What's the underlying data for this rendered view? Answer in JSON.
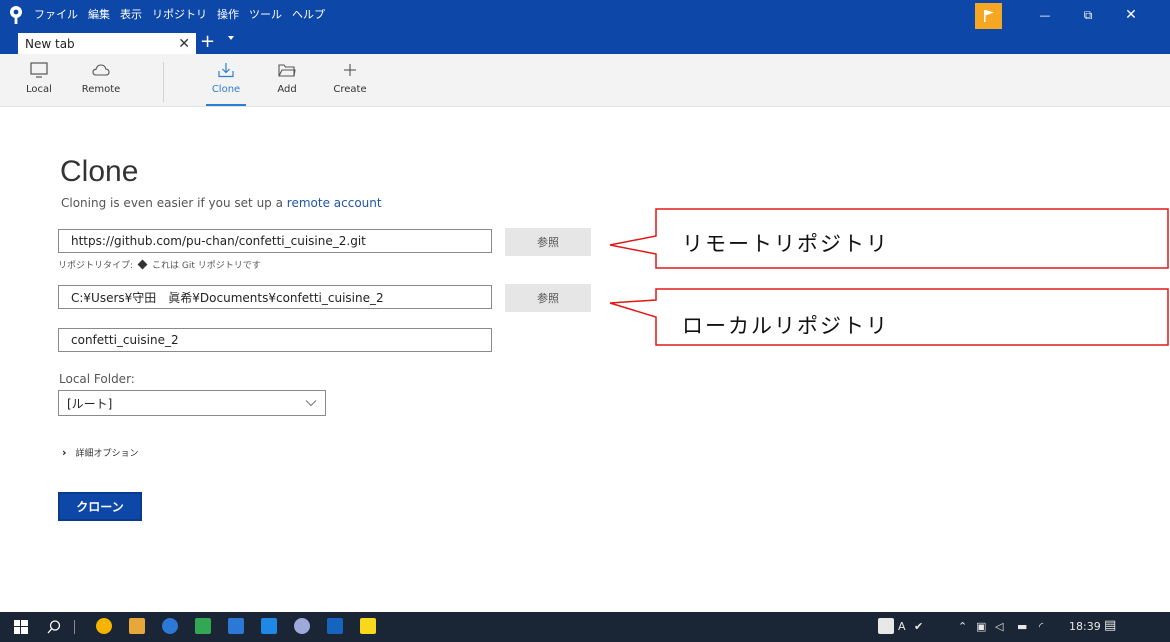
{
  "menu": [
    "ファイル",
    "編集",
    "表示",
    "リポジトリ",
    "操作",
    "ツール",
    "ヘルプ"
  ],
  "tab": {
    "title": "New tab",
    "close": "✕",
    "add": "+"
  },
  "window_controls": {
    "minimize": "—",
    "restore": "⧉",
    "close": "✕"
  },
  "toolbar": {
    "local": "Local",
    "remote": "Remote",
    "clone": "Clone",
    "add": "Add",
    "create": "Create"
  },
  "clone": {
    "title": "Clone",
    "subtitle_prefix": "Cloning is even easier if you set up a ",
    "subtitle_link": "remote account",
    "source_url": "https://github.com/pu-chan/confetti_cuisine_2.git",
    "browse_label": "参照",
    "repo_type_label": "リポジトリタイプ:",
    "repo_type_value": "これは Git リポジトリです",
    "destination_path": "C:¥Users¥守田　眞希¥Documents¥confetti_cuisine_2",
    "name": "confetti_cuisine_2",
    "local_folder_label": "Local Folder:",
    "local_folder_value": "[ルート]",
    "advanced_label": "詳細オプション",
    "clone_button": "クローン"
  },
  "callouts": {
    "remote": "リモートリポジトリ",
    "local": "ローカルリポジトリ"
  },
  "taskbar": {
    "time": "18:39",
    "tray_text": "A"
  },
  "colors": {
    "titlebar": "#0d47a8",
    "accent": "#2a7fd4",
    "callout_border": "#e01818",
    "flag": "#f5a623"
  }
}
